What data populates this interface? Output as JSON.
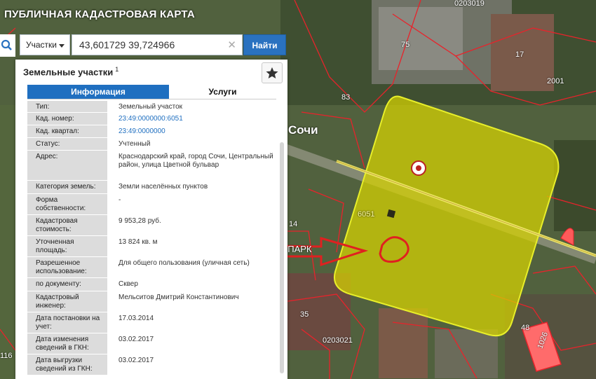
{
  "app": {
    "title": "ПУБЛИЧНАЯ КАДАСТРОВАЯ КАРТА"
  },
  "search": {
    "category": "Участки",
    "query": "43,601729 39,724966",
    "submit_label": "Найти"
  },
  "panel": {
    "title": "Земельные участки",
    "count": "1",
    "tabs": [
      "Информация",
      "Услуги"
    ],
    "rows": [
      {
        "label": "Тип:",
        "value": "Земельный участок"
      },
      {
        "label": "Кад. номер:",
        "value": "23:49:0000000:6051"
      },
      {
        "label": "Кад. квартал:",
        "value": "23:49:0000000"
      },
      {
        "label": "Статус:",
        "value": "Учтенный"
      },
      {
        "label": "Адрес:",
        "value": "Краснодарский край, город Сочи, Центральный район, улица Цветной бульвар"
      },
      {
        "label": "Категория земель:",
        "value": "Земли населённых пунктов"
      },
      {
        "label": "Форма собственности:",
        "value": "-"
      },
      {
        "label": "Кадастровая стоимость:",
        "value": "9 953,28 руб."
      },
      {
        "label": "Уточненная площадь:",
        "value": "13 824 кв. м"
      },
      {
        "label": "Разрешенное использование:",
        "value": "Для общего пользования (уличная сеть)"
      },
      {
        "label": "по документу:",
        "value": "Сквер"
      },
      {
        "label": "Кадастровый инженер:",
        "value": "Мельситов Дмитрий Константинович"
      },
      {
        "label": "Дата постановки на учет:",
        "value": "17.03.2014"
      },
      {
        "label": "Дата изменения сведений в ГКН:",
        "value": "03.02.2017"
      },
      {
        "label": "Дата выгрузки сведений из ГКН:",
        "value": "03.02.2017"
      }
    ]
  },
  "map": {
    "labels": {
      "top_quarter": "0203019",
      "bottom_quarter": "0203021",
      "plot_75": "75",
      "plot_17": "17",
      "plot_2001": "2001",
      "plot_83": "83",
      "plot_6051": "6051",
      "plot_14": "14",
      "plot_35": "35",
      "plot_48": "48",
      "plot_1026": "1026",
      "plot_116": "116",
      "city": "Сочи"
    },
    "annotation": "СКЕЙТ-ПАРК",
    "colors": {
      "parcel_fill": "#d8d400",
      "parcel_border": "#e8ef2a",
      "boundary": "#e8232b",
      "arrow": "#e02020",
      "accent": "#2a72c0"
    }
  }
}
